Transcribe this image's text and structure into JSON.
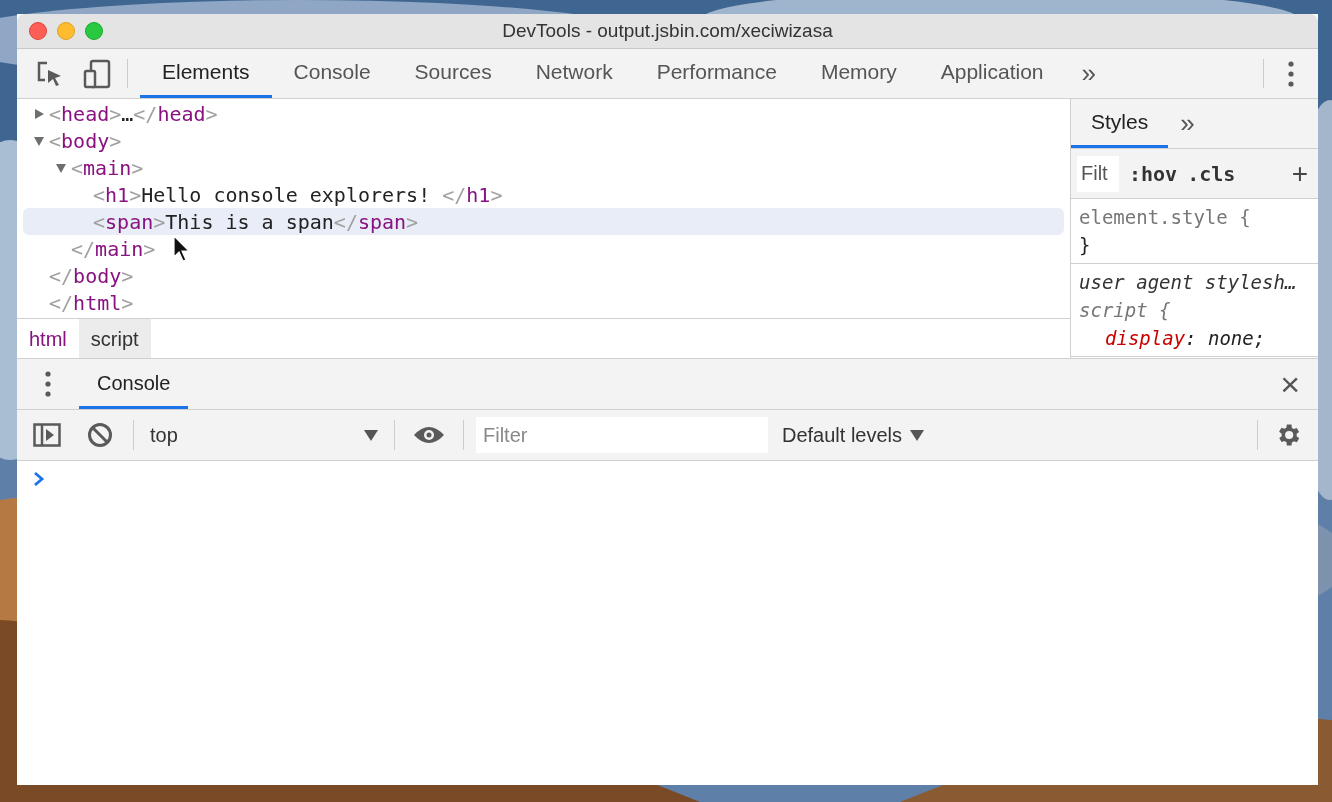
{
  "window": {
    "title": "DevTools - output.jsbin.com/xeciwizasa"
  },
  "main_tabs": [
    {
      "label": "Elements",
      "selected": true
    },
    {
      "label": "Console",
      "selected": false
    },
    {
      "label": "Sources",
      "selected": false
    },
    {
      "label": "Network",
      "selected": false
    },
    {
      "label": "Performance",
      "selected": false
    },
    {
      "label": "Memory",
      "selected": false
    },
    {
      "label": "Application",
      "selected": false
    }
  ],
  "more_tabs": "»",
  "elements_tree": [
    {
      "kind": "element",
      "open": "<head>",
      "text": "…",
      "close": "</head>",
      "expanded": false,
      "selected": false
    },
    {
      "kind": "element",
      "open": "<body>",
      "close": "</body>",
      "expanded": true,
      "selected": false,
      "children": [
        {
          "kind": "element",
          "open": "<main>",
          "close": "</main>",
          "expanded": true,
          "selected": false,
          "children": [
            {
              "kind": "element",
              "open": "<h1>",
              "text": "Hello console explorers! ",
              "close": "</h1>",
              "selected": false
            },
            {
              "kind": "element",
              "open": "<span>",
              "text": "This is a span",
              "close": "</span>",
              "selected": true
            }
          ]
        }
      ]
    },
    {
      "kind": "closing",
      "close": "</html>"
    }
  ],
  "breadcrumbs": [
    {
      "label": "html",
      "selected": false
    },
    {
      "label": "script",
      "selected": true
    }
  ],
  "sidebar": {
    "tabs": [
      {
        "label": "Styles",
        "selected": true
      }
    ],
    "more": "»",
    "filter": {
      "placeholder": "Filt"
    },
    "hov": ":hov",
    "cls": ".cls",
    "add": "+",
    "rules": [
      {
        "selector": "element.style {",
        "close": "}",
        "italic": false
      },
      {
        "origin": "user agent stylesh…",
        "selector": "script {",
        "italic": true,
        "declarations": [
          {
            "property": "display",
            "value": ": none;"
          }
        ]
      }
    ]
  },
  "drawer": {
    "tabs": [
      {
        "label": "Console",
        "selected": true
      }
    ],
    "close": "×"
  },
  "console_toolbar": {
    "context": "top",
    "filter": {
      "placeholder": "Filter"
    },
    "levels": "Default levels"
  }
}
